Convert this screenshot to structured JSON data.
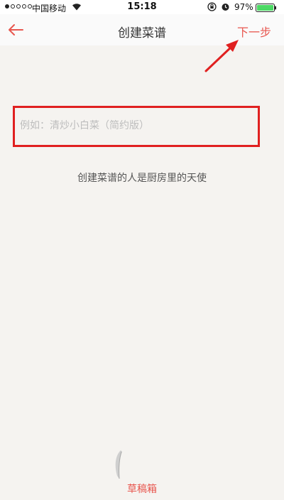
{
  "status_bar": {
    "carrier": "中国移动",
    "time": "15:18",
    "battery_percent": "97%"
  },
  "nav": {
    "title": "创建菜谱",
    "back_icon": "back-arrow-icon",
    "next_label": "下一步"
  },
  "form": {
    "name_placeholder": "例如：清炒小白菜（简约版）",
    "name_value": ""
  },
  "tagline": "创建菜谱的人是厨房里的天使",
  "footer": {
    "drafts_label": "草稿箱",
    "drafts_icon": "feather-icon"
  },
  "colors": {
    "accent": "#e8574f",
    "annotation": "#e02020",
    "background": "#f5f3f0"
  }
}
